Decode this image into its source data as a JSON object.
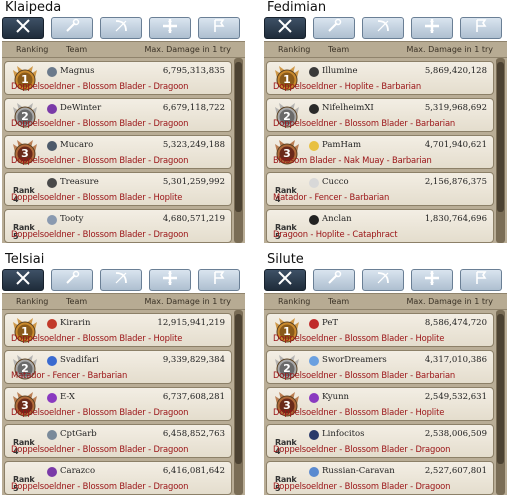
{
  "headers": {
    "ranking": "Ranking",
    "team": "Team",
    "damage": "Max. Damage in 1 try"
  },
  "colors": {
    "gold": "#c98a2e",
    "silver": "#8e8e8e",
    "bronze": "#8a4a2a",
    "class_text": "#9a1316"
  },
  "tab_icons": [
    "swords-icon",
    "staff-icon",
    "bow-icon",
    "cross-icon",
    "banner-icon"
  ],
  "rank_badges": [
    "1",
    "2",
    "3",
    "Rank 4",
    "Rank 5"
  ],
  "servers": [
    {
      "name": "Klaipeda",
      "active_tab": 0,
      "rows": [
        {
          "team": "Magnus",
          "damage": "6,795,313,835",
          "classes": "Doppelsoeldner - Blossom Blader - Dragoon",
          "icon": "trophy-icon",
          "icon_color": "#6b7a8c"
        },
        {
          "team": "DeWinter",
          "damage": "6,679,118,722",
          "classes": "Doppelsoeldner - Blossom Blader - Dragoon",
          "icon": "purple-sigil-icon",
          "icon_color": "#7a3aa8"
        },
        {
          "team": "Mucaro",
          "damage": "5,323,249,188",
          "classes": "Doppelsoeldner - Blossom Blader - Dragoon",
          "icon": "cup-icon",
          "icon_color": "#4d5a6a"
        },
        {
          "team": "Treasure",
          "damage": "5,301,259,992",
          "classes": "Doppelsoeldner - Blossom Blader - Hoplite",
          "icon": "beetle-icon",
          "icon_color": "#4a4a4a"
        },
        {
          "team": "Tooty",
          "damage": "4,680,571,219",
          "classes": "Doppelsoeldner - Blossom Blader - Dragoon",
          "icon": "ghost-icon",
          "icon_color": "#8a9ab0"
        }
      ]
    },
    {
      "name": "Fedimian",
      "active_tab": 0,
      "rows": [
        {
          "team": "Illumine",
          "damage": "5,869,420,128",
          "classes": "Doppelsoeldner - Hoplite - Barbarian",
          "icon": "round-icon",
          "icon_color": "#3a3a3a"
        },
        {
          "team": "NifelheimXI",
          "damage": "5,319,968,692",
          "classes": "Doppelsoeldner - Blossom Blader - Barbarian",
          "icon": "skull-icon",
          "icon_color": "#2a2a2a"
        },
        {
          "team": "PamHam",
          "damage": "4,701,940,621",
          "classes": "Blossom Blader - Nak Muay - Barbarian",
          "icon": "chick-icon",
          "icon_color": "#e8c040"
        },
        {
          "team": "Cucco",
          "damage": "2,156,876,375",
          "classes": "Matador - Fencer - Barbarian",
          "icon": "bird-icon",
          "icon_color": "#d8d8d8"
        },
        {
          "team": "Anclan",
          "damage": "1,830,764,696",
          "classes": "Dragoon - Hoplite - Cataphract",
          "icon": "moon-icon",
          "icon_color": "#222222"
        }
      ]
    },
    {
      "name": "Telsiai",
      "active_tab": 0,
      "rows": [
        {
          "team": "Kirarin",
          "damage": "12,915,941,219",
          "classes": "Doppelsoeldner - Blossom Blader - Hoplite",
          "icon": "fox-icon",
          "icon_color": "#c23a2a"
        },
        {
          "team": "Svadifari",
          "damage": "9,339,829,384",
          "classes": "Matador - Fencer - Barbarian",
          "icon": "blue-crest-icon",
          "icon_color": "#3a6ad0"
        },
        {
          "team": "E-X",
          "damage": "6,737,608,281",
          "classes": "Doppelsoeldner - Blossom Blader - Dragoon",
          "icon": "purple-wing-icon",
          "icon_color": "#8a3ac0"
        },
        {
          "team": "CptGarb",
          "damage": "6,458,852,763",
          "classes": "Doppelsoeldner - Blossom Blader - Dragoon",
          "icon": "helmet-icon",
          "icon_color": "#7a8a9a"
        },
        {
          "team": "Carazco",
          "damage": "6,416,081,642",
          "classes": "Doppelsoeldner - Blossom Blader - Dragoon",
          "icon": "purple-bird-icon",
          "icon_color": "#7a3aa8"
        }
      ]
    },
    {
      "name": "Silute",
      "active_tab": 0,
      "rows": [
        {
          "team": "PeT",
          "damage": "8,586,474,720",
          "classes": "Doppelsoeldner - Blossom Blader - Hoplite",
          "icon": "red-emblem-icon",
          "icon_color": "#c02a2a"
        },
        {
          "team": "SworDreamers",
          "damage": "4,317,010,386",
          "classes": "Doppelsoeldner - Blossom Blader - Barbarian",
          "icon": "cloud-icon",
          "icon_color": "#6aa0e0"
        },
        {
          "team": "Kyunn",
          "damage": "2,549,532,631",
          "classes": "Doppelsoeldner - Blossom Blader - Hoplite",
          "icon": "purple-eye-icon",
          "icon_color": "#8a3ac0"
        },
        {
          "team": "Linfocitos",
          "damage": "2,538,006,509",
          "classes": "Doppelsoeldner - Blossom Blader - Dragoon",
          "icon": "shield-icon",
          "icon_color": "#2a3a6a"
        },
        {
          "team": "Russian-Caravan",
          "damage": "2,527,607,801",
          "classes": "Doppelsoeldner - Blossom Blader - Dragoon",
          "icon": "cart-icon",
          "icon_color": "#5a8ad0"
        }
      ]
    }
  ]
}
